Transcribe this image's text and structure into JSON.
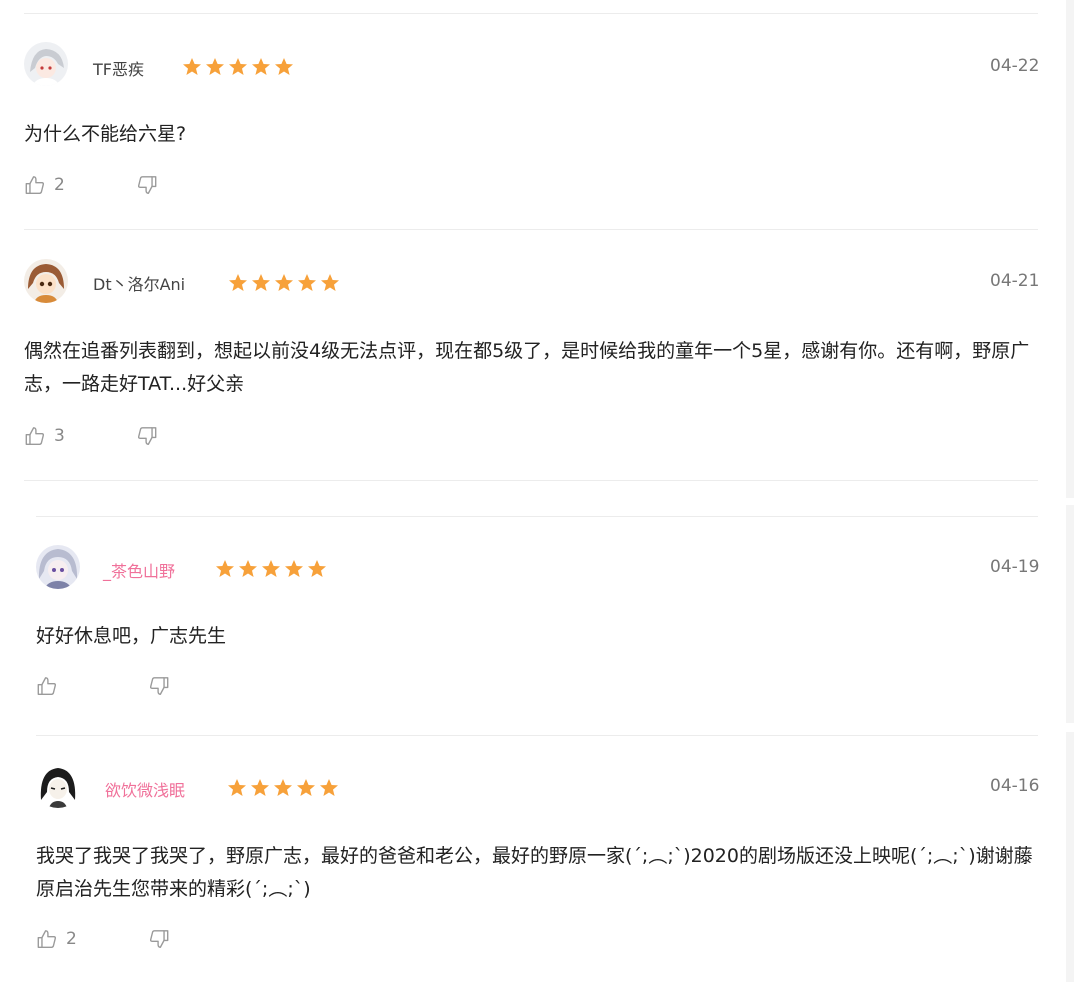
{
  "colors": {
    "star": "#f7a13a",
    "pink_name": "#f0719a",
    "text": "#222222",
    "muted": "#888888"
  },
  "reviews": [
    {
      "username": "TF恶疾",
      "rating_stars": 5,
      "date": "04-22",
      "content": "为什么不能给六星?",
      "likes": "2",
      "avatar_icon": "white-haired-anime-avatar"
    },
    {
      "username": "Dt丶洛尔Ani",
      "rating_stars": 5,
      "date": "04-21",
      "content": "偶然在追番列表翻到，想起以前没4级无法点评，现在都5级了，是时候给我的童年一个5星，感谢有你。还有啊，野原广志，一路走好TAT...好父亲",
      "likes": "3",
      "avatar_icon": "brown-haired-anime-avatar"
    },
    {
      "username": "_茶色山野",
      "rating_stars": 5,
      "date": "04-19",
      "content": "好好休息吧，广志先生",
      "likes": "",
      "avatar_icon": "silver-haired-anime-avatar"
    },
    {
      "username": "欲饮微浅眠",
      "rating_stars": 5,
      "date": "04-16",
      "content": "我哭了我哭了我哭了，野原广志，最好的爸爸和老公，最好的野原一家(´;︵;`)2020的剧场版还没上映呢(´;︵;`)谢谢藤原启治先生您带来的精彩(´;︵;`)",
      "likes": "2",
      "avatar_icon": "black-haired-anime-avatar"
    }
  ]
}
